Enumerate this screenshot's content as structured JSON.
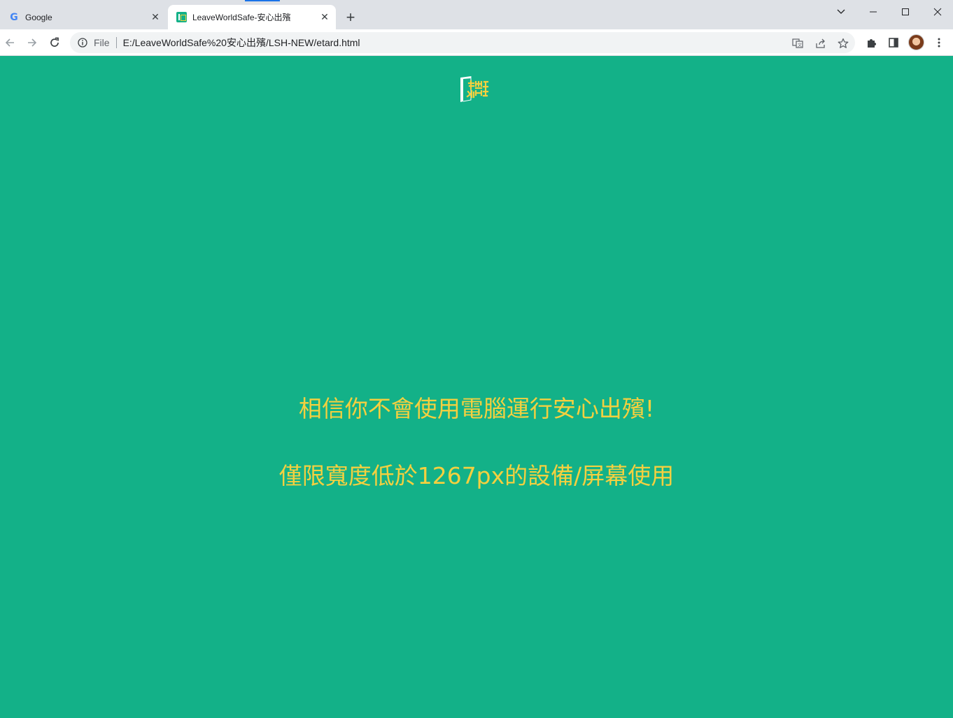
{
  "browser": {
    "tabs": [
      {
        "title": "Google",
        "favicon": "google-g-icon",
        "active": false
      },
      {
        "title": "LeaveWorldSafe-安心出殯",
        "favicon": "leaveworldsafe-favicon",
        "active": true
      }
    ],
    "address_bar": {
      "scheme_label": "File",
      "url": "E:/LeaveWorldSafe%20安心出殯/LSH-NEW/etard.html"
    }
  },
  "page": {
    "background_color": "#13b188",
    "text_color": "#f4d03f",
    "logo": "leaveworldsafe-logo",
    "message_line1": "相信你不會使用電腦運行安心出殯!",
    "message_line2": "僅限寬度低於1267px的設備/屏幕使用"
  }
}
